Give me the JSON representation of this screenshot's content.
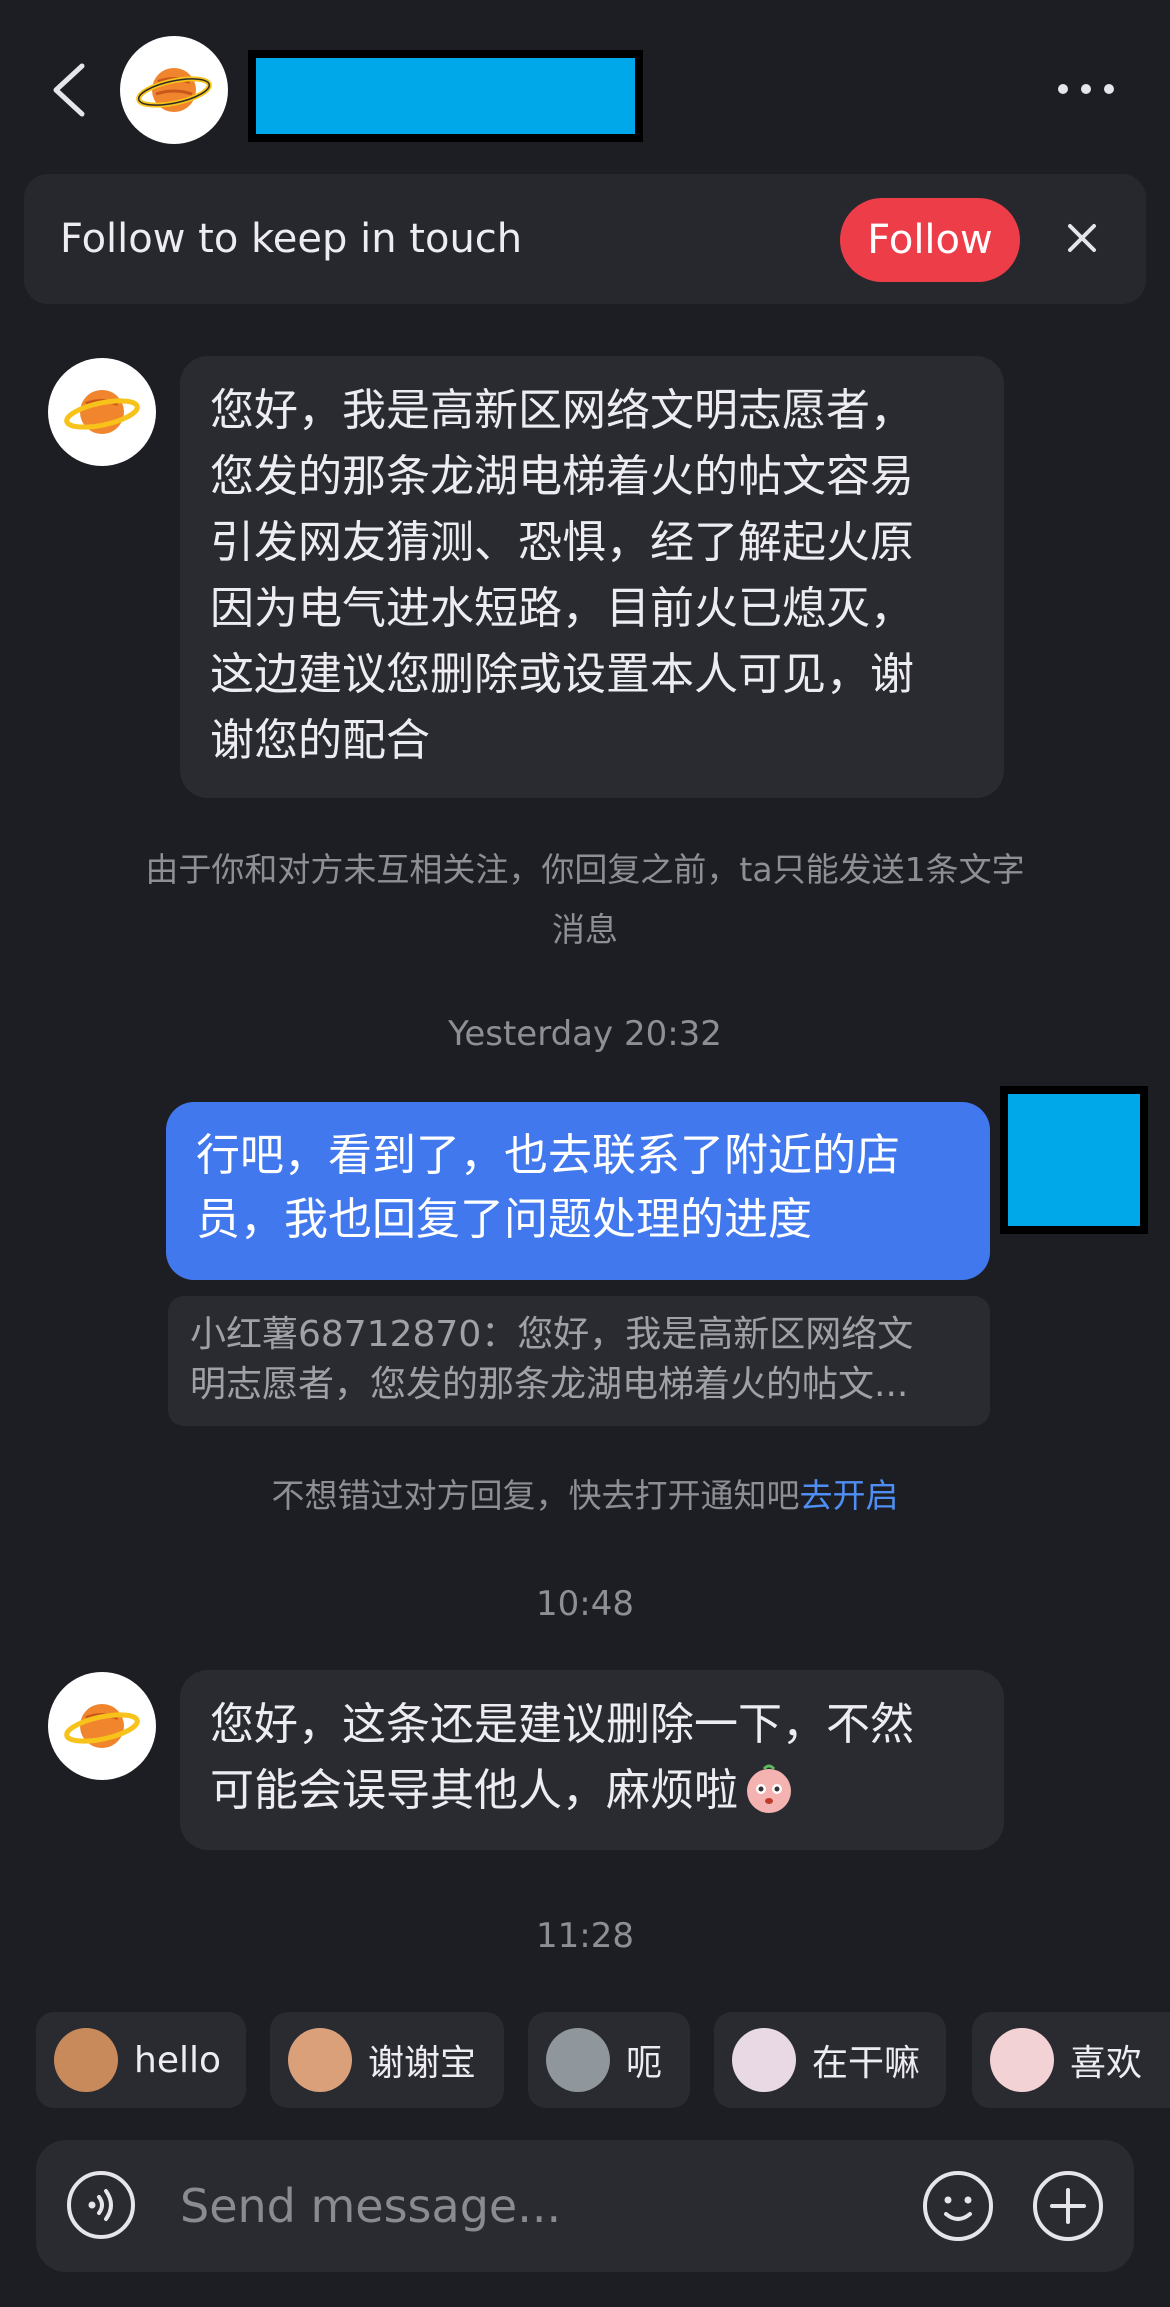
{
  "header": {
    "back_icon": "chevron-left-icon",
    "avatar_icon": "planet-icon",
    "more_icon": "more-dots-icon"
  },
  "banner": {
    "text": "Follow to keep in touch",
    "follow_label": "Follow",
    "close_icon": "close-icon",
    "accent": "#ec3d48"
  },
  "messages": [
    {
      "sender": "other",
      "lines": [
        "您好，我是高新区网络文明志愿者，",
        "您发的那条龙湖电梯着火的帖文容易",
        "引发网友猜测、恐惧，经了解起火原",
        "因为电气进水短路，目前火已熄灭，",
        "这边建议您删除或设置本人可见，谢",
        "谢您的配合"
      ]
    },
    {
      "sender": "self",
      "lines": [
        "行吧，看到了，也去联系了附近的店",
        "员，我也回复了问题处理的进度"
      ],
      "quote_lines": [
        "小红薯68712870：您好，我是高新区网络文",
        "明志愿者，您发的那条龙湖电梯着火的帖文..."
      ]
    },
    {
      "sender": "other",
      "lines": [
        "您好，这条还是建议删除一下，不然",
        "可能会误导其他人，麻烦啦"
      ]
    }
  ],
  "notices": {
    "limit_line1": "由于你和对方未互相关注，你回复之前，ta只能发送1条文字",
    "limit_line2": "消息",
    "notify_text": "不想错过对方回复，快去打开通知吧",
    "notify_link": "去开启"
  },
  "timestamps": [
    "Yesterday 20:32",
    "10:48",
    "11:28"
  ],
  "quick_replies": [
    {
      "label": "hello",
      "icon": "monkey-emoji-icon"
    },
    {
      "label": "谢谢宝",
      "icon": "thanks-emoji-icon"
    },
    {
      "label": "呃",
      "icon": "cat-emoji-icon"
    },
    {
      "label": "在干嘛",
      "icon": "peek-emoji-icon"
    },
    {
      "label": "喜欢",
      "icon": "love-emoji-icon"
    }
  ],
  "input": {
    "placeholder": "Send message...",
    "voice_icon": "voice-icon",
    "emoji_icon": "smiley-icon",
    "plus_icon": "plus-icon"
  },
  "colors": {
    "background": "#1d1e24",
    "self_bubble": "#4178ee",
    "other_bubble": "#2a2b31",
    "link": "#4f8ff5"
  }
}
